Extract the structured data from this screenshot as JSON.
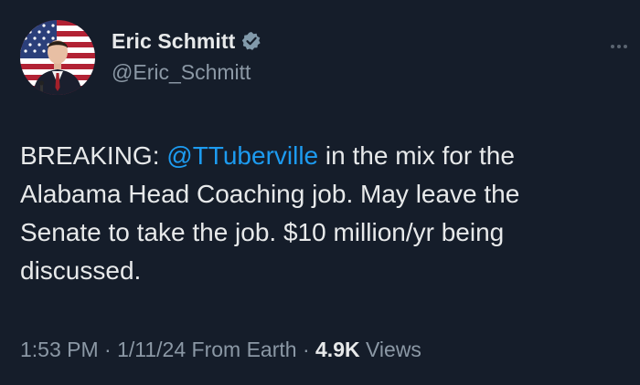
{
  "author": {
    "name": "Eric Schmitt",
    "handle": "@Eric_Schmitt",
    "verified": true
  },
  "tweet": {
    "text_prefix": "BREAKING: ",
    "mention": "@TTuberville",
    "text_line1_rest": " in the mix for the",
    "text_line2": "Alabama Head Coaching job. May leave the",
    "text_line3": "Senate to take the job. $10 million/yr being",
    "text_line4": "discussed."
  },
  "meta": {
    "time": "1:53 PM",
    "separator": " · ",
    "date": "1/11/24",
    "location": " From Earth",
    "separator2": " · ",
    "views_count": "4.9K",
    "views_label": " Views"
  },
  "colors": {
    "background": "#151d2a",
    "mention": "#1d9bf0",
    "verified_badge": "#829aab"
  },
  "icons": {
    "verified": "verified-badge-icon",
    "more": "more-options-icon"
  }
}
